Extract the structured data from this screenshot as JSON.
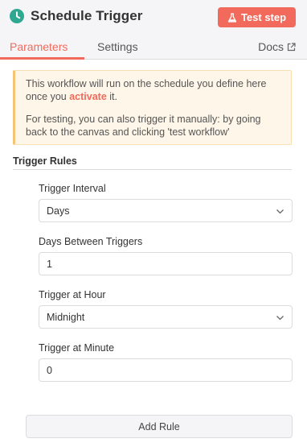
{
  "header": {
    "node_title": "Schedule Trigger",
    "test_step_label": "Test step",
    "node_icon": "clock-icon",
    "accent_color": "#f26a5b"
  },
  "tabs": [
    {
      "label": "Parameters",
      "active": true
    },
    {
      "label": "Settings",
      "active": false
    }
  ],
  "docs_label": "Docs",
  "notice": {
    "line1_before": "This workflow will run on the schedule you define here once you ",
    "line1_link": "activate",
    "line1_after": " it.",
    "line2": "For testing, you can also trigger it manually: by going back to the canvas and clicking 'test workflow'"
  },
  "rules": {
    "section_title": "Trigger Rules",
    "fields": [
      {
        "label": "Trigger Interval",
        "type": "select",
        "value": "Days"
      },
      {
        "label": "Days Between Triggers",
        "type": "input",
        "value": "1"
      },
      {
        "label": "Trigger at Hour",
        "type": "select",
        "value": "Midnight"
      },
      {
        "label": "Trigger at Minute",
        "type": "input",
        "value": "0"
      }
    ],
    "add_rule_label": "Add Rule"
  }
}
